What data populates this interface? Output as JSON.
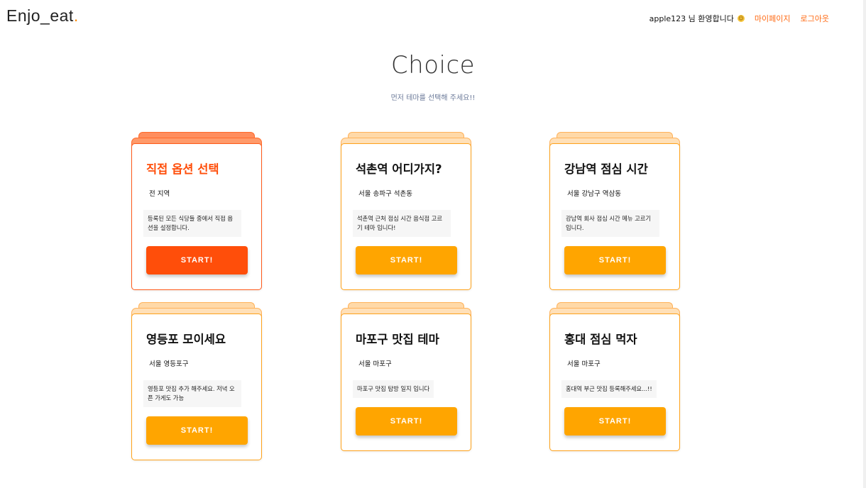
{
  "header": {
    "logo_text": "Enjo_eat",
    "logo_dot": ".",
    "welcome": "apple123 님 환영합니다",
    "mypage": "마이페이지",
    "logout": "로그아웃"
  },
  "main": {
    "title": "Choice",
    "subtitle": "먼저 테마를 선택해 주세요!!"
  },
  "start_label": "START!",
  "cards": [
    {
      "title": "직접 옵션 선택",
      "region": "전 지역",
      "description": "등록된 모든 식당들 중에서 직접 옵션을 설정합니다."
    },
    {
      "title": "석촌역 어디가지?",
      "region": "서울 송파구 석촌동",
      "description": "석촌역 근처 점심 시간 음식점 고르기 테마 입니다!"
    },
    {
      "title": "강남역 점심 시간",
      "region": "서울 강남구 역삼동",
      "description": "강남역 회사 점심 시간 메뉴 고르기 입니다."
    },
    {
      "title": "영등포 모이세요",
      "region": "서울 영등포구",
      "description": "영등포 맛집 추가 해주세요. 저녁 오픈 가게도 가능"
    },
    {
      "title": "마포구 맛집 테마",
      "region": "서울 마포구",
      "description": "마포구 맛집 탐방 일지 입니다"
    },
    {
      "title": "홍대 점심 먹자",
      "region": "서울 마포구",
      "description": "홍대역 부근 맛집 등록해주세요...!!"
    }
  ],
  "colors": {
    "accent": "#ffa500",
    "selected": "#ff4e0a",
    "link": "#ff6a13"
  }
}
